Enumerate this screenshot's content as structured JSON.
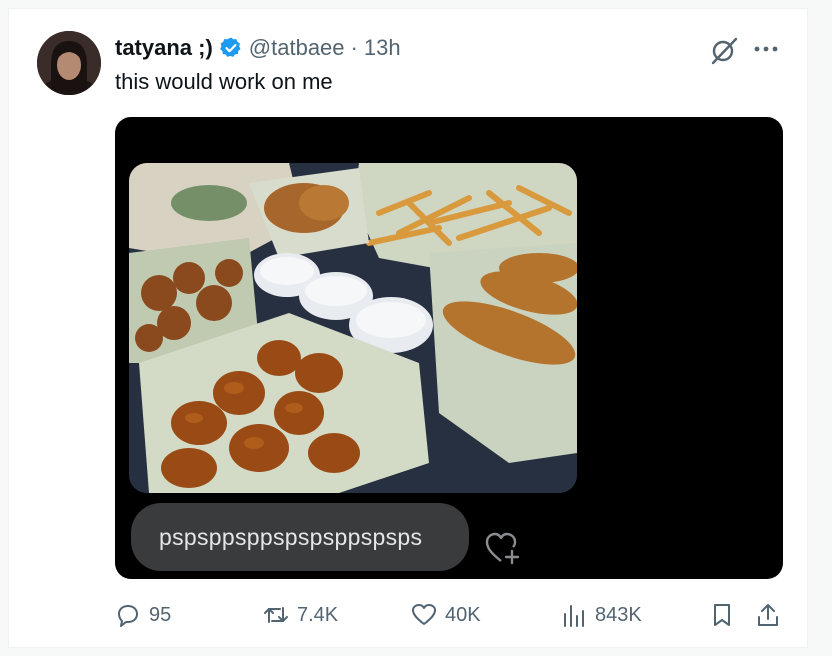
{
  "post": {
    "author": {
      "display_name": "tatyana ;)",
      "handle": "@tatbaee",
      "separator": "·",
      "time": "13h",
      "verified": true
    },
    "text": "this would work on me",
    "media": {
      "chat_bubble_text": "pspsppsppspspsppspsps"
    },
    "actions": {
      "replies": "95",
      "reposts": "7.4K",
      "likes": "40K",
      "views": "843K"
    }
  },
  "colors": {
    "verified_blue": "#1d9bf0",
    "secondary_text": "#536471",
    "primary_text": "#0f1419",
    "media_background": "#000000",
    "bubble_background": "#3a3b3d"
  },
  "icons": {
    "reply": "speech-bubble-icon",
    "repost": "repost-arrows-icon",
    "like": "heart-icon",
    "views": "bar-chart-icon",
    "bookmark": "bookmark-icon",
    "share": "share-upload-icon",
    "grok": "grok-slash-icon",
    "more": "more-horizontal-icon",
    "react": "heart-plus-icon"
  }
}
